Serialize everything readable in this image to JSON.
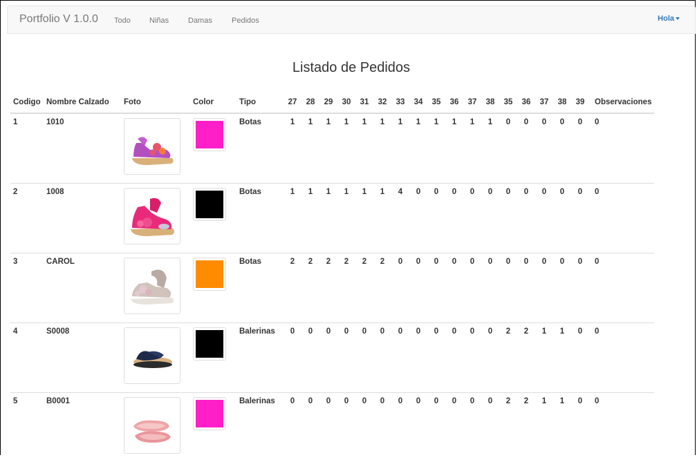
{
  "navbar": {
    "brand": "Portfolio V 1.0.0",
    "links": [
      "Todo",
      "Niñas",
      "Damas",
      "Pedidos"
    ],
    "user_menu": "Hola"
  },
  "page_title": "Listado de Pedidos",
  "table": {
    "headers": {
      "codigo": "Codigo",
      "nombre": "Nombre Calzado",
      "foto": "Foto",
      "color": "Color",
      "tipo": "Tipo",
      "sizes": [
        "27",
        "28",
        "29",
        "30",
        "31",
        "32",
        "33",
        "34",
        "35",
        "36",
        "37",
        "38",
        "35",
        "36",
        "37",
        "38",
        "39"
      ],
      "observaciones": "Observaciones"
    },
    "rows": [
      {
        "codigo": "1",
        "nombre": "1010",
        "color": "#ff1fc8",
        "tipo": "Botas",
        "photo": "pink-purple-sandal",
        "sizes": [
          "1",
          "1",
          "1",
          "1",
          "1",
          "1",
          "1",
          "1",
          "1",
          "1",
          "1",
          "1",
          "0",
          "0",
          "0",
          "0",
          "0"
        ],
        "observaciones": "0"
      },
      {
        "codigo": "2",
        "nombre": "1008",
        "color": "#000000",
        "tipo": "Botas",
        "photo": "pink-sandal",
        "sizes": [
          "1",
          "1",
          "1",
          "1",
          "1",
          "1",
          "4",
          "0",
          "0",
          "0",
          "0",
          "0",
          "0",
          "0",
          "0",
          "0",
          "0"
        ],
        "observaciones": "0"
      },
      {
        "codigo": "3",
        "nombre": "CAROL",
        "color": "#ff8c00",
        "tipo": "Botas",
        "photo": "grey-sandal",
        "sizes": [
          "2",
          "2",
          "2",
          "2",
          "2",
          "2",
          "0",
          "0",
          "0",
          "0",
          "0",
          "0",
          "0",
          "0",
          "0",
          "0",
          "0"
        ],
        "observaciones": "0"
      },
      {
        "codigo": "4",
        "nombre": "S0008",
        "color": "#000000",
        "tipo": "Balerinas",
        "photo": "navy-flipflop",
        "sizes": [
          "0",
          "0",
          "0",
          "0",
          "0",
          "0",
          "0",
          "0",
          "0",
          "0",
          "0",
          "0",
          "2",
          "2",
          "1",
          "1",
          "0"
        ],
        "observaciones": "0"
      },
      {
        "codigo": "5",
        "nombre": "B0001",
        "color": "#ff1fc8",
        "tipo": "Balerinas",
        "photo": "pink-ballerina",
        "sizes": [
          "0",
          "0",
          "0",
          "0",
          "0",
          "0",
          "0",
          "0",
          "0",
          "0",
          "0",
          "0",
          "2",
          "2",
          "1",
          "1",
          "0"
        ],
        "observaciones": "0"
      }
    ]
  }
}
